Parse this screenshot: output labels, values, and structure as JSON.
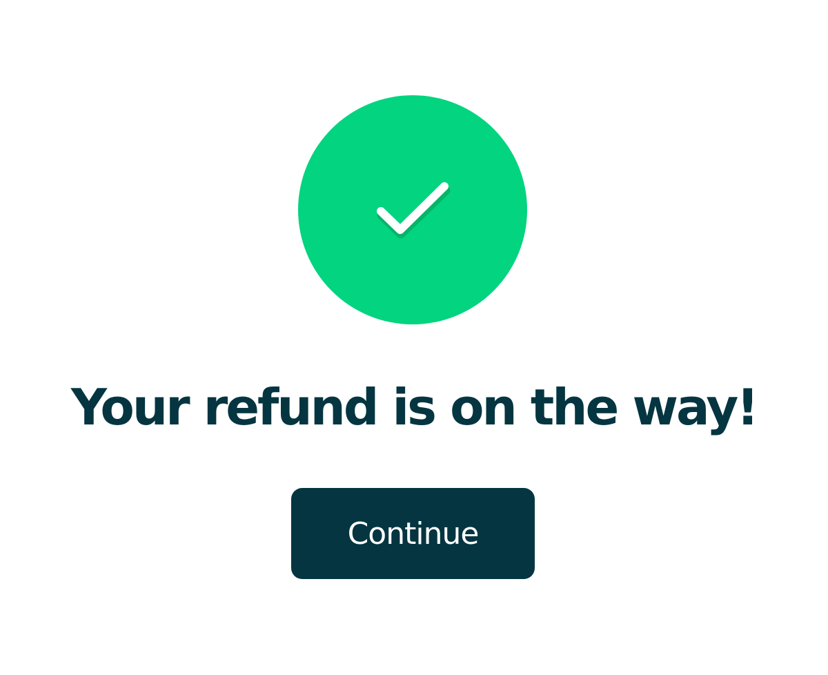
{
  "status": {
    "icon": "checkmark-icon",
    "circle_color": "#02d47f",
    "check_color": "#ffffff"
  },
  "headline": {
    "text": "Your refund is on the way!",
    "color": "#053540"
  },
  "continue_button": {
    "label": "Continue",
    "background": "#053540",
    "text_color": "#ffffff"
  }
}
